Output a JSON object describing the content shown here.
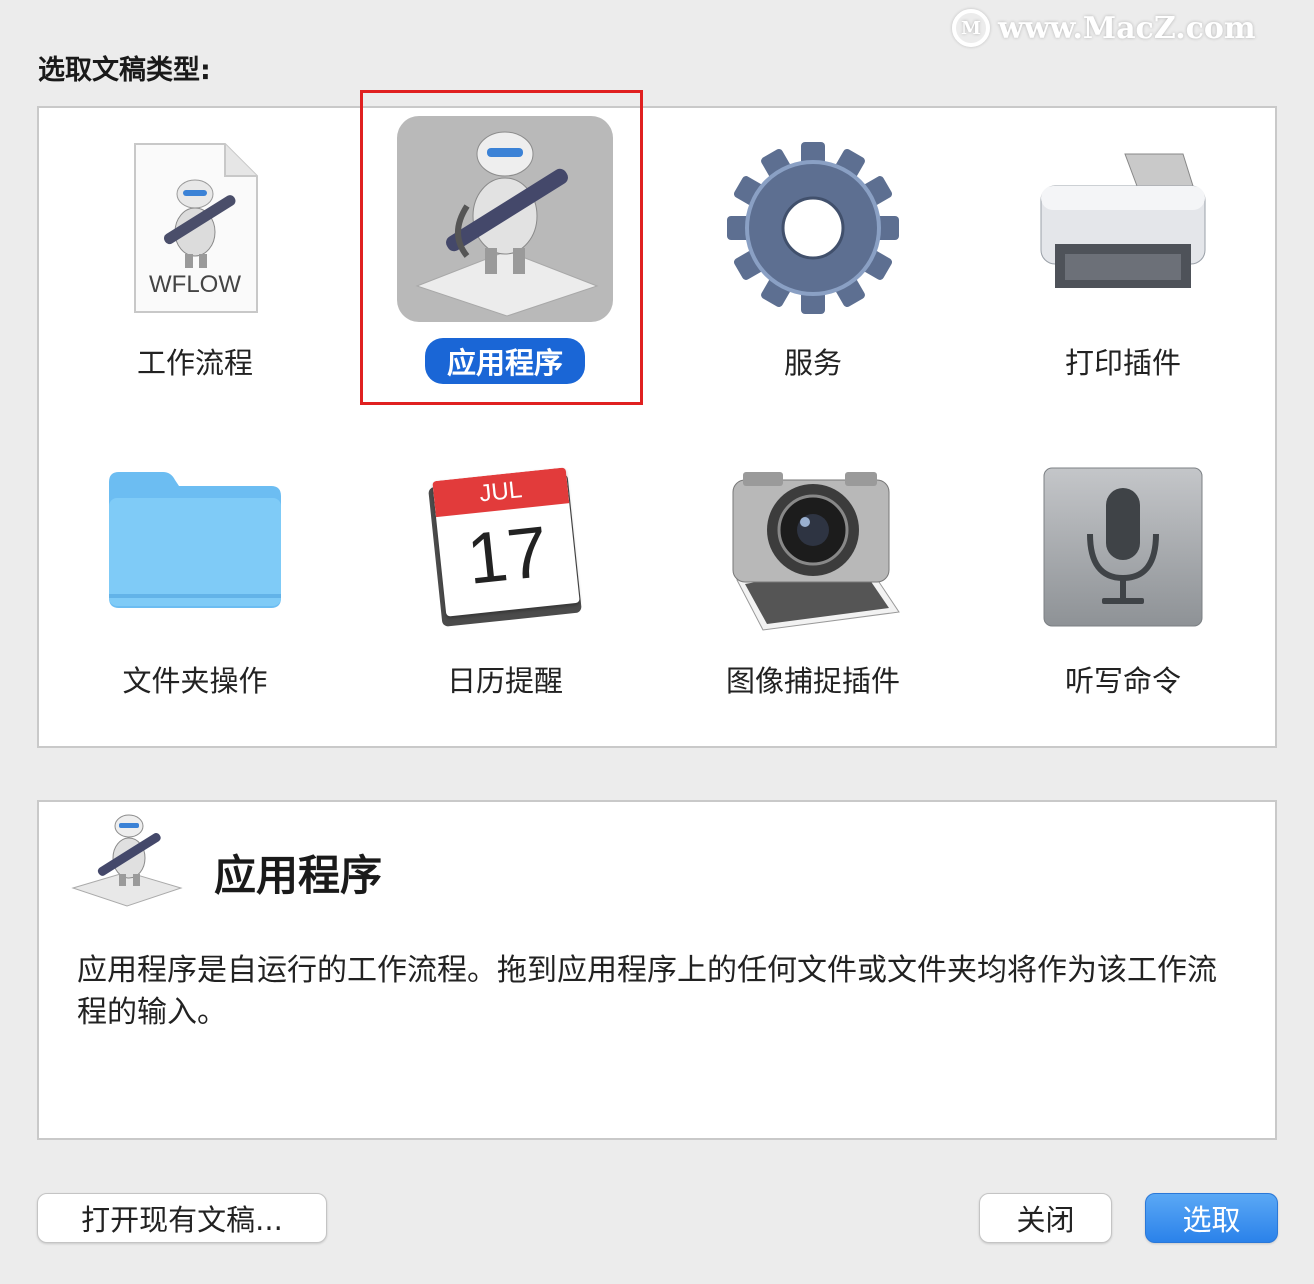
{
  "watermark": {
    "text": "www.MacZ.com",
    "logo": "M"
  },
  "heading": "选取文稿类型:",
  "types": [
    {
      "label": "工作流程",
      "icon": "workflow-file-icon",
      "badge": "WFLOW"
    },
    {
      "label": "应用程序",
      "icon": "automator-robot-icon",
      "selected": true
    },
    {
      "label": "服务",
      "icon": "gear-icon"
    },
    {
      "label": "打印插件",
      "icon": "printer-icon"
    },
    {
      "label": "文件夹操作",
      "icon": "folder-icon"
    },
    {
      "label": "日历提醒",
      "icon": "calendar-icon",
      "month": "JUL",
      "day": "17"
    },
    {
      "label": "图像捕捉插件",
      "icon": "camera-icon"
    },
    {
      "label": "听写命令",
      "icon": "microphone-icon"
    }
  ],
  "description": {
    "title": "应用程序",
    "text": "应用程序是自运行的工作流程。拖到应用程序上的任何文件或文件夹均将作为该工作流程的输入。"
  },
  "buttons": {
    "open": "打开现有文稿...",
    "close": "关闭",
    "choose": "选取"
  },
  "colors": {
    "selection": "#1a66d6",
    "highlight_box": "#e02020",
    "primary_button": "#2b82ea"
  }
}
